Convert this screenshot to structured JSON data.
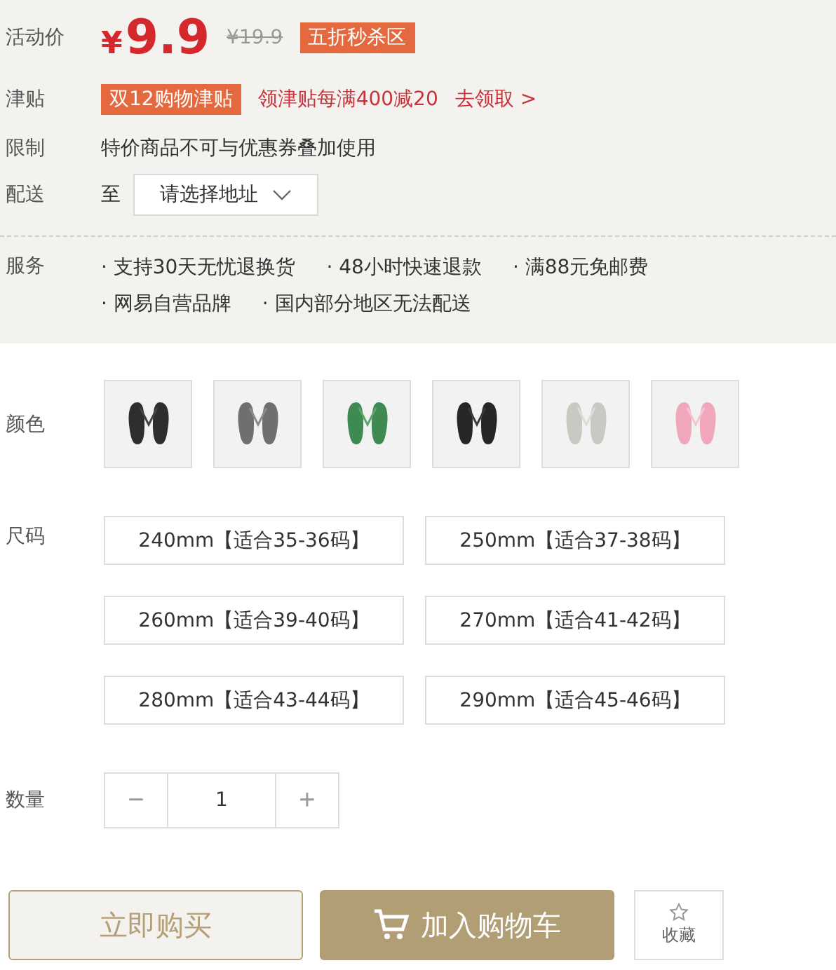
{
  "price": {
    "label": "活动价",
    "currency": "¥",
    "value": "9.9",
    "original": "¥19.9",
    "badge": "五折秒杀区"
  },
  "subsidy": {
    "label": "津贴",
    "tag": "双12购物津贴",
    "text": "领津贴每满400减20",
    "link": "去领取 >"
  },
  "limit": {
    "label": "限制",
    "text": "特价商品不可与优惠券叠加使用"
  },
  "delivery": {
    "label": "配送",
    "prefix": "至",
    "select": "请选择地址"
  },
  "service": {
    "label": "服务",
    "items": [
      "· 支持30天无忧退换货",
      "· 48小时快速退款",
      "· 满88元免邮费",
      "· 网易自营品牌",
      "· 国内部分地区无法配送"
    ]
  },
  "colors": {
    "label": "颜色"
  },
  "sizes": {
    "label": "尺码",
    "options": [
      {
        "label": "240mm【适合35-36码】",
        "selected": false
      },
      {
        "label": "250mm【适合37-38码】",
        "selected": false
      },
      {
        "label": "260mm【适合39-40码】",
        "selected": false
      },
      {
        "label": "270mm【适合41-42码】",
        "selected": false
      },
      {
        "label": "280mm【适合43-44码】",
        "selected": false
      },
      {
        "label": "290mm【适合45-46码】",
        "selected": false
      }
    ]
  },
  "quantity": {
    "label": "数量",
    "minus": "−",
    "value": "1",
    "plus": "+"
  },
  "actions": {
    "buy": "立即购买",
    "cart": "加入购物车",
    "favorite": "收藏"
  }
}
